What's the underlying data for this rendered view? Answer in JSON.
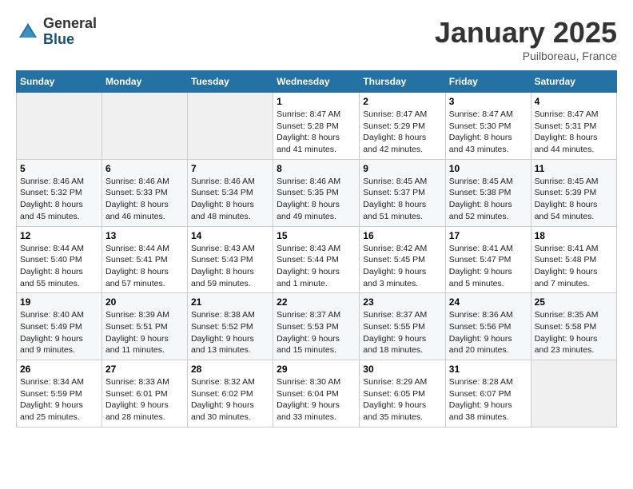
{
  "logo": {
    "general": "General",
    "blue": "Blue"
  },
  "title": "January 2025",
  "location": "Puilboreau, France",
  "days_of_week": [
    "Sunday",
    "Monday",
    "Tuesday",
    "Wednesday",
    "Thursday",
    "Friday",
    "Saturday"
  ],
  "weeks": [
    [
      {
        "day": "",
        "content": ""
      },
      {
        "day": "",
        "content": ""
      },
      {
        "day": "",
        "content": ""
      },
      {
        "day": "1",
        "content": "Sunrise: 8:47 AM\nSunset: 5:28 PM\nDaylight: 8 hours\nand 41 minutes."
      },
      {
        "day": "2",
        "content": "Sunrise: 8:47 AM\nSunset: 5:29 PM\nDaylight: 8 hours\nand 42 minutes."
      },
      {
        "day": "3",
        "content": "Sunrise: 8:47 AM\nSunset: 5:30 PM\nDaylight: 8 hours\nand 43 minutes."
      },
      {
        "day": "4",
        "content": "Sunrise: 8:47 AM\nSunset: 5:31 PM\nDaylight: 8 hours\nand 44 minutes."
      }
    ],
    [
      {
        "day": "5",
        "content": "Sunrise: 8:46 AM\nSunset: 5:32 PM\nDaylight: 8 hours\nand 45 minutes."
      },
      {
        "day": "6",
        "content": "Sunrise: 8:46 AM\nSunset: 5:33 PM\nDaylight: 8 hours\nand 46 minutes."
      },
      {
        "day": "7",
        "content": "Sunrise: 8:46 AM\nSunset: 5:34 PM\nDaylight: 8 hours\nand 48 minutes."
      },
      {
        "day": "8",
        "content": "Sunrise: 8:46 AM\nSunset: 5:35 PM\nDaylight: 8 hours\nand 49 minutes."
      },
      {
        "day": "9",
        "content": "Sunrise: 8:45 AM\nSunset: 5:37 PM\nDaylight: 8 hours\nand 51 minutes."
      },
      {
        "day": "10",
        "content": "Sunrise: 8:45 AM\nSunset: 5:38 PM\nDaylight: 8 hours\nand 52 minutes."
      },
      {
        "day": "11",
        "content": "Sunrise: 8:45 AM\nSunset: 5:39 PM\nDaylight: 8 hours\nand 54 minutes."
      }
    ],
    [
      {
        "day": "12",
        "content": "Sunrise: 8:44 AM\nSunset: 5:40 PM\nDaylight: 8 hours\nand 55 minutes."
      },
      {
        "day": "13",
        "content": "Sunrise: 8:44 AM\nSunset: 5:41 PM\nDaylight: 8 hours\nand 57 minutes."
      },
      {
        "day": "14",
        "content": "Sunrise: 8:43 AM\nSunset: 5:43 PM\nDaylight: 8 hours\nand 59 minutes."
      },
      {
        "day": "15",
        "content": "Sunrise: 8:43 AM\nSunset: 5:44 PM\nDaylight: 9 hours\nand 1 minute."
      },
      {
        "day": "16",
        "content": "Sunrise: 8:42 AM\nSunset: 5:45 PM\nDaylight: 9 hours\nand 3 minutes."
      },
      {
        "day": "17",
        "content": "Sunrise: 8:41 AM\nSunset: 5:47 PM\nDaylight: 9 hours\nand 5 minutes."
      },
      {
        "day": "18",
        "content": "Sunrise: 8:41 AM\nSunset: 5:48 PM\nDaylight: 9 hours\nand 7 minutes."
      }
    ],
    [
      {
        "day": "19",
        "content": "Sunrise: 8:40 AM\nSunset: 5:49 PM\nDaylight: 9 hours\nand 9 minutes."
      },
      {
        "day": "20",
        "content": "Sunrise: 8:39 AM\nSunset: 5:51 PM\nDaylight: 9 hours\nand 11 minutes."
      },
      {
        "day": "21",
        "content": "Sunrise: 8:38 AM\nSunset: 5:52 PM\nDaylight: 9 hours\nand 13 minutes."
      },
      {
        "day": "22",
        "content": "Sunrise: 8:37 AM\nSunset: 5:53 PM\nDaylight: 9 hours\nand 15 minutes."
      },
      {
        "day": "23",
        "content": "Sunrise: 8:37 AM\nSunset: 5:55 PM\nDaylight: 9 hours\nand 18 minutes."
      },
      {
        "day": "24",
        "content": "Sunrise: 8:36 AM\nSunset: 5:56 PM\nDaylight: 9 hours\nand 20 minutes."
      },
      {
        "day": "25",
        "content": "Sunrise: 8:35 AM\nSunset: 5:58 PM\nDaylight: 9 hours\nand 23 minutes."
      }
    ],
    [
      {
        "day": "26",
        "content": "Sunrise: 8:34 AM\nSunset: 5:59 PM\nDaylight: 9 hours\nand 25 minutes."
      },
      {
        "day": "27",
        "content": "Sunrise: 8:33 AM\nSunset: 6:01 PM\nDaylight: 9 hours\nand 28 minutes."
      },
      {
        "day": "28",
        "content": "Sunrise: 8:32 AM\nSunset: 6:02 PM\nDaylight: 9 hours\nand 30 minutes."
      },
      {
        "day": "29",
        "content": "Sunrise: 8:30 AM\nSunset: 6:04 PM\nDaylight: 9 hours\nand 33 minutes."
      },
      {
        "day": "30",
        "content": "Sunrise: 8:29 AM\nSunset: 6:05 PM\nDaylight: 9 hours\nand 35 minutes."
      },
      {
        "day": "31",
        "content": "Sunrise: 8:28 AM\nSunset: 6:07 PM\nDaylight: 9 hours\nand 38 minutes."
      },
      {
        "day": "",
        "content": ""
      }
    ]
  ]
}
